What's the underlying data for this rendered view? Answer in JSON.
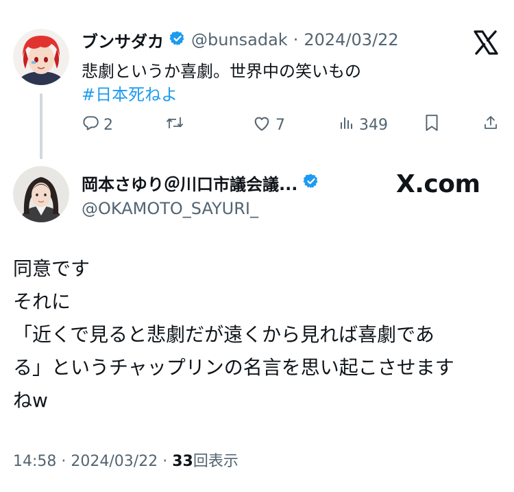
{
  "parent": {
    "display_name": "ブンサダカ",
    "handle": "@bunsadak",
    "separator": "·",
    "date": "2024/03/22",
    "text": "悲劇というか喜劇。世界中の笑いもの",
    "hashtag": "#日本死ねよ",
    "actions": {
      "replies": "2",
      "retweets": "",
      "likes": "7",
      "views": "349"
    }
  },
  "reply": {
    "display_name": "岡本さゆり＠川口市議会議...",
    "handle": "@OKAMOTO_SAYURI_",
    "watermark": "X.com",
    "body": "同意です\nそれに\n「近くで見ると悲劇だが遠くから見れば喜劇であ\nる」というチャップリンの名言を思い起こさせます\nねw",
    "time": "14:58",
    "separator": "·",
    "date": "2024/03/22",
    "views_count": "33",
    "views_label": "回表示"
  },
  "colors": {
    "text_primary": "#0f1419",
    "text_secondary": "#536471",
    "link": "#1d9bf0",
    "verified": "#1d9bf0",
    "thread_line": "#cfd9de"
  },
  "icons": {
    "verified": "verified-badge-icon",
    "x_logo": "x-logo-icon",
    "reply": "reply-icon",
    "retweet": "retweet-icon",
    "like": "heart-icon",
    "views": "views-bar-chart-icon",
    "bookmark": "bookmark-icon",
    "share": "share-icon"
  }
}
